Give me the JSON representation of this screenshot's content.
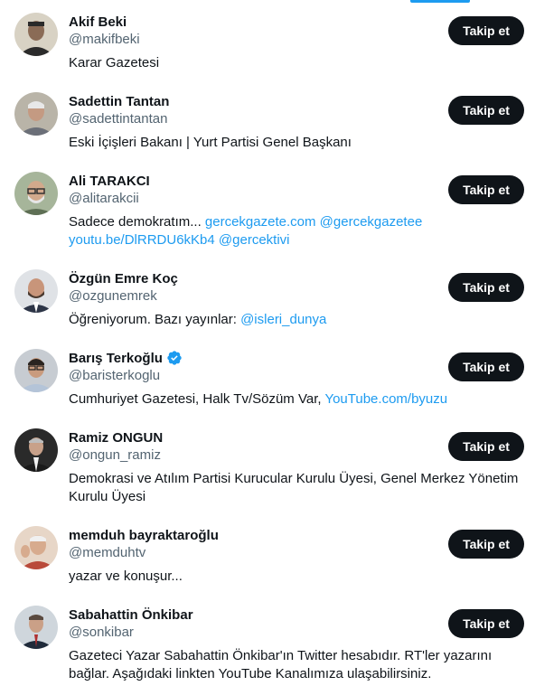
{
  "button_label": "Takip et",
  "colors": {
    "accent": "#1d9bf0",
    "button_bg": "#0f1419",
    "secondary_text": "#536471"
  },
  "users": [
    {
      "name": "Akif Beki",
      "handle": "@makifbeki",
      "verified": false,
      "bio": [
        {
          "text": "Karar Gazetesi"
        }
      ]
    },
    {
      "name": "Sadettin Tantan",
      "handle": "@sadettintantan",
      "verified": false,
      "bio": [
        {
          "text": "Eski İçişleri Bakanı | Yurt Partisi Genel Başkanı"
        }
      ]
    },
    {
      "name": "Ali TARAKCI",
      "handle": "@alitarakcii",
      "verified": false,
      "bio": [
        {
          "text": "Sadece demokratım... "
        },
        {
          "text": "gercekgazete.com",
          "link": true
        },
        {
          "text": " "
        },
        {
          "text": "@gercekgazetee",
          "link": true
        },
        {
          "text": " "
        },
        {
          "text": "youtu.be/DlRRDU6kKb4",
          "link": true
        },
        {
          "text": " "
        },
        {
          "text": "@gercektivi",
          "link": true
        }
      ]
    },
    {
      "name": "Özgün Emre Koç",
      "handle": "@ozgunemrek",
      "verified": false,
      "bio": [
        {
          "text": "Öğreniyorum. Bazı yayınlar: "
        },
        {
          "text": "@isleri_dunya",
          "link": true
        }
      ]
    },
    {
      "name": "Barış Terkoğlu",
      "handle": "@baristerkoglu",
      "verified": true,
      "bio": [
        {
          "text": "Cumhuriyet Gazetesi, Halk Tv/Sözüm Var, "
        },
        {
          "text": "YouTube.com/byuzu",
          "link": true
        }
      ]
    },
    {
      "name": "Ramiz ONGUN",
      "handle": "@ongun_ramiz",
      "verified": false,
      "bio": [
        {
          "text": "Demokrasi ve Atılım Partisi Kurucular Kurulu Üyesi, Genel Merkez Yönetim Kurulu Üyesi"
        }
      ]
    },
    {
      "name": "memduh bayraktaroğlu",
      "handle": "@memduhtv",
      "verified": false,
      "bio": [
        {
          "text": "yazar ve konuşur..."
        }
      ]
    },
    {
      "name": "Sabahattin Önkibar",
      "handle": "@sonkibar",
      "verified": false,
      "bio": [
        {
          "text": "Gazeteci Yazar Sabahattin Önkibar'ın Twitter hesabıdır. RT'ler yazarını bağlar. Aşağıdaki linkten YouTube Kanalımıza ulaşabilirsiniz."
        }
      ]
    }
  ]
}
